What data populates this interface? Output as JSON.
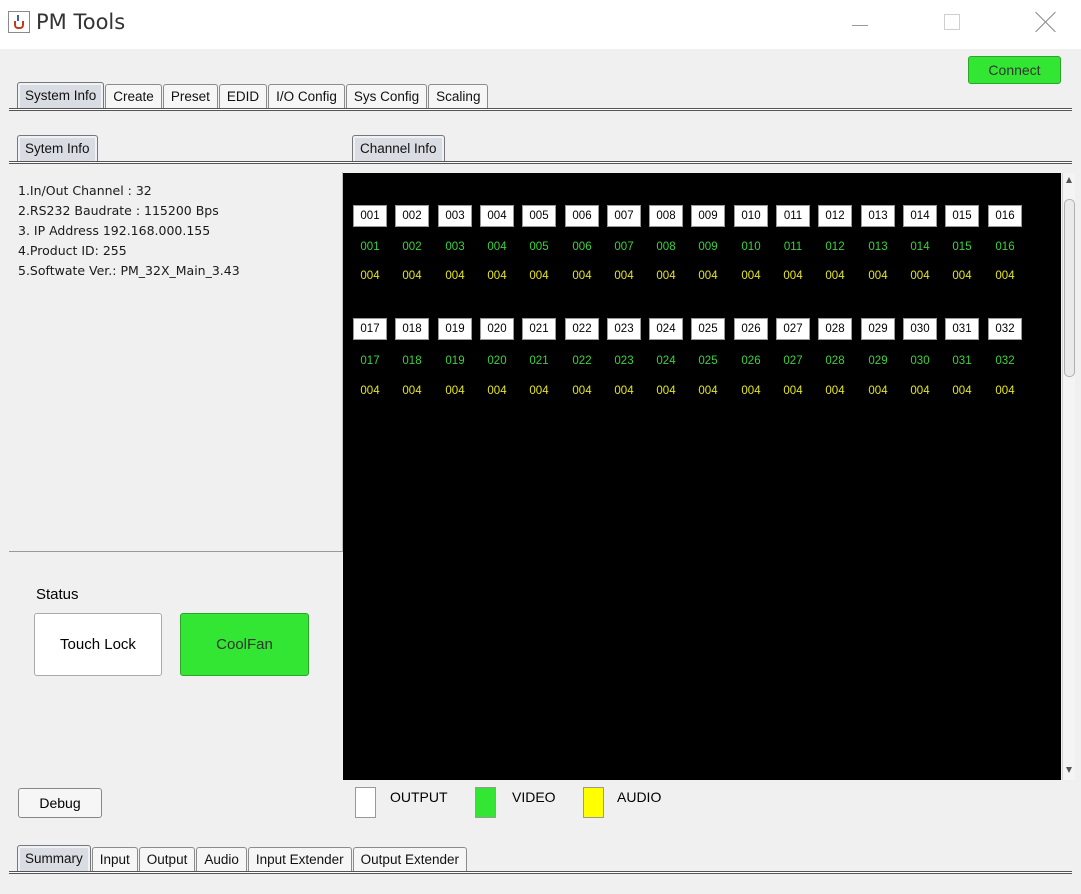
{
  "window": {
    "title": "PM Tools"
  },
  "connect_label": "Connect",
  "main_tabs": [
    "System Info",
    "Create",
    "Preset",
    "EDID",
    "I/O Config",
    "Sys Config",
    "Scaling"
  ],
  "left_tab": "Sytem Info",
  "right_tab": "Channel Info",
  "system_info": [
    "1.In/Out Channel : 32",
    "2.RS232 Baudrate : 115200 Bps",
    "3. IP Address 192.168.000.155",
    "4.Product ID: 255",
    "5.Softwate Ver.: PM_32X_Main_3.43"
  ],
  "status": {
    "label": "Status",
    "touch_lock": "Touch Lock",
    "cool_fan": "CoolFan"
  },
  "channels": {
    "row1": {
      "output": [
        "001",
        "002",
        "003",
        "004",
        "005",
        "006",
        "007",
        "008",
        "009",
        "010",
        "011",
        "012",
        "013",
        "014",
        "015",
        "016"
      ],
      "video": [
        "001",
        "002",
        "003",
        "004",
        "005",
        "006",
        "007",
        "008",
        "009",
        "010",
        "011",
        "012",
        "013",
        "014",
        "015",
        "016"
      ],
      "audio": [
        "004",
        "004",
        "004",
        "004",
        "004",
        "004",
        "004",
        "004",
        "004",
        "004",
        "004",
        "004",
        "004",
        "004",
        "004",
        "004"
      ]
    },
    "row2": {
      "output": [
        "017",
        "018",
        "019",
        "020",
        "021",
        "022",
        "023",
        "024",
        "025",
        "026",
        "027",
        "028",
        "029",
        "030",
        "031",
        "032"
      ],
      "video": [
        "017",
        "018",
        "019",
        "020",
        "021",
        "022",
        "023",
        "024",
        "025",
        "026",
        "027",
        "028",
        "029",
        "030",
        "031",
        "032"
      ],
      "audio": [
        "004",
        "004",
        "004",
        "004",
        "004",
        "004",
        "004",
        "004",
        "004",
        "004",
        "004",
        "004",
        "004",
        "004",
        "004",
        "004"
      ]
    }
  },
  "legend": {
    "output": "OUTPUT",
    "video": "VIDEO",
    "audio": "AUDIO",
    "output_color": "#ffffff",
    "video_color": "#33e633",
    "audio_color": "#ffff00"
  },
  "debug_label": "Debug",
  "bottom_tabs": [
    "Summary",
    "Input",
    "Output",
    "Audio",
    "Input Extender",
    "Output Extender"
  ],
  "colors": {
    "accent_green": "#33e633",
    "video_text": "#3bd23b",
    "audio_text": "#e6e61e",
    "panel_bg": "#000000"
  }
}
